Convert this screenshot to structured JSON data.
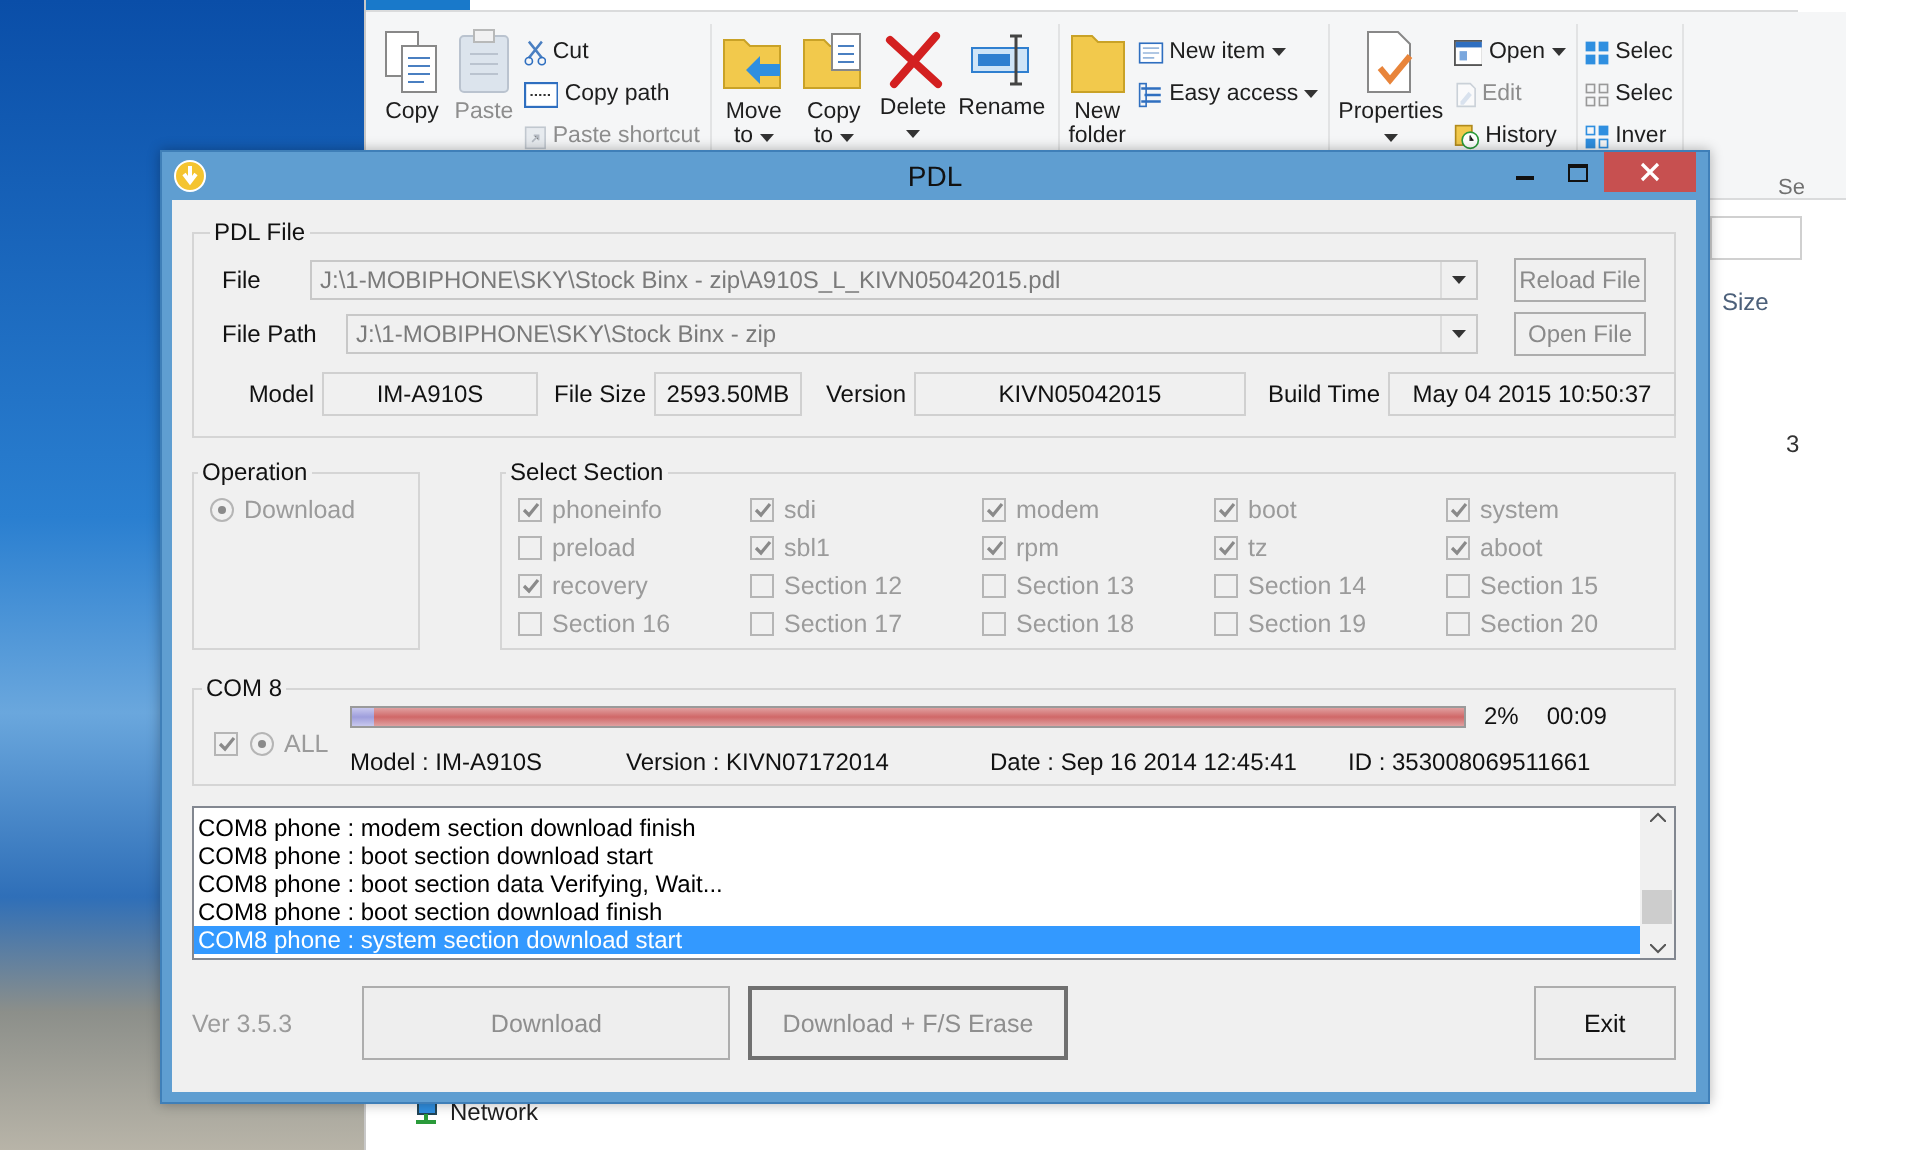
{
  "explorer": {
    "ribbon": {
      "groups": [
        {
          "items": [
            {
              "kind": "large",
              "label": "Copy",
              "disabled": false,
              "dropdown": false
            },
            {
              "kind": "large",
              "label": "Paste",
              "disabled": true,
              "dropdown": false
            },
            {
              "kind": "stack",
              "children": [
                {
                  "label": "Cut",
                  "disabled": false,
                  "dropdown": false
                },
                {
                  "label": "Copy path",
                  "disabled": false,
                  "dropdown": false
                },
                {
                  "label": "Paste shortcut",
                  "disabled": true,
                  "dropdown": false
                }
              ]
            }
          ]
        },
        {
          "items": [
            {
              "kind": "large",
              "label": "Move to",
              "disabled": false,
              "dropdown": true
            },
            {
              "kind": "large",
              "label": "Copy to",
              "disabled": false,
              "dropdown": true
            },
            {
              "kind": "large",
              "label": "Delete",
              "disabled": false,
              "dropdown": true
            },
            {
              "kind": "large",
              "label": "Rename",
              "disabled": false,
              "dropdown": false
            }
          ]
        },
        {
          "items": [
            {
              "kind": "large",
              "label": "New folder",
              "disabled": false,
              "dropdown": false
            },
            {
              "kind": "stack",
              "children": [
                {
                  "label": "New item",
                  "disabled": false,
                  "dropdown": true
                },
                {
                  "label": "Easy access",
                  "disabled": false,
                  "dropdown": true
                }
              ]
            }
          ]
        },
        {
          "items": [
            {
              "kind": "large",
              "label": "Properties",
              "disabled": false,
              "dropdown": true
            },
            {
              "kind": "stack",
              "children": [
                {
                  "label": "Open",
                  "disabled": false,
                  "dropdown": true
                },
                {
                  "label": "Edit",
                  "disabled": true,
                  "dropdown": false
                },
                {
                  "label": "History",
                  "disabled": false,
                  "dropdown": false
                }
              ]
            }
          ]
        },
        {
          "items": [
            {
              "kind": "stack",
              "children": [
                {
                  "label": "Selec",
                  "disabled": false,
                  "dropdown": false
                },
                {
                  "label": "Selec",
                  "disabled": false,
                  "dropdown": false
                },
                {
                  "label": "Inver",
                  "disabled": false,
                  "dropdown": false
                }
              ]
            }
          ]
        }
      ],
      "group_label": "Se"
    },
    "column_header": "Size",
    "cell": "3",
    "nav_item": "Network"
  },
  "pdl": {
    "title": "PDL",
    "file_group": {
      "legend": "PDL File",
      "file": {
        "label": "File",
        "value": "J:\\1-MOBIPHONE\\SKY\\Stock Binx - zip\\A910S_L_KIVN05042015.pdl",
        "button": "Reload File"
      },
      "file_path": {
        "label": "File Path",
        "value": "J:\\1-MOBIPHONE\\SKY\\Stock Binx - zip",
        "button": "Open File"
      },
      "info": [
        {
          "label": "Model",
          "value": "IM-A910S"
        },
        {
          "label": "File Size",
          "value": "2593.50MB"
        },
        {
          "label": "Version",
          "value": "KIVN05042015"
        },
        {
          "label": "Build Time",
          "value": "May 04 2015  10:50:37"
        }
      ]
    },
    "operation": {
      "legend": "Operation",
      "options": [
        {
          "label": "Download",
          "selected": true
        }
      ]
    },
    "sections": {
      "legend": "Select Section",
      "items": [
        {
          "label": "phoneinfo",
          "checked": true
        },
        {
          "label": "sdi",
          "checked": true
        },
        {
          "label": "modem",
          "checked": true
        },
        {
          "label": "boot",
          "checked": true
        },
        {
          "label": "system",
          "checked": true
        },
        {
          "label": "preload",
          "checked": false
        },
        {
          "label": "sbl1",
          "checked": true
        },
        {
          "label": "rpm",
          "checked": true
        },
        {
          "label": "tz",
          "checked": true
        },
        {
          "label": "aboot",
          "checked": true
        },
        {
          "label": "recovery",
          "checked": true
        },
        {
          "label": "Section 12",
          "checked": false
        },
        {
          "label": "Section 13",
          "checked": false
        },
        {
          "label": "Section 14",
          "checked": false
        },
        {
          "label": "Section 15",
          "checked": false
        },
        {
          "label": "Section 16",
          "checked": false
        },
        {
          "label": "Section 17",
          "checked": false
        },
        {
          "label": "Section 18",
          "checked": false
        },
        {
          "label": "Section 19",
          "checked": false
        },
        {
          "label": "Section 20",
          "checked": false
        }
      ]
    },
    "com": {
      "legend": "COM 8",
      "checked": true,
      "all": {
        "label": "ALL",
        "selected": true
      },
      "progress": {
        "level": 0.02
      },
      "percent": "2%",
      "time": "00:09",
      "model": "Model : IM-A910S",
      "version": "Version : KIVN07172014",
      "date": "Date :  Sep 16 2014  12:45:41",
      "id": "ID : 353008069511661"
    },
    "log": [
      {
        "text": "COM8 phone : modem section download finish",
        "selected": false
      },
      {
        "text": "COM8 phone : boot section download start",
        "selected": false
      },
      {
        "text": "COM8 phone : boot section data Verifying, Wait...",
        "selected": false
      },
      {
        "text": "COM8 phone : boot section download finish",
        "selected": false
      },
      {
        "text": "COM8 phone : system section download start",
        "selected": true
      }
    ],
    "version": "Ver 3.5.3",
    "buttons": [
      {
        "label": "Download",
        "disabled": true,
        "focused": false
      },
      {
        "label": "Download + F/S Erase",
        "disabled": true,
        "focused": true
      },
      {
        "label": "Exit",
        "disabled": false,
        "focused": false
      }
    ]
  }
}
